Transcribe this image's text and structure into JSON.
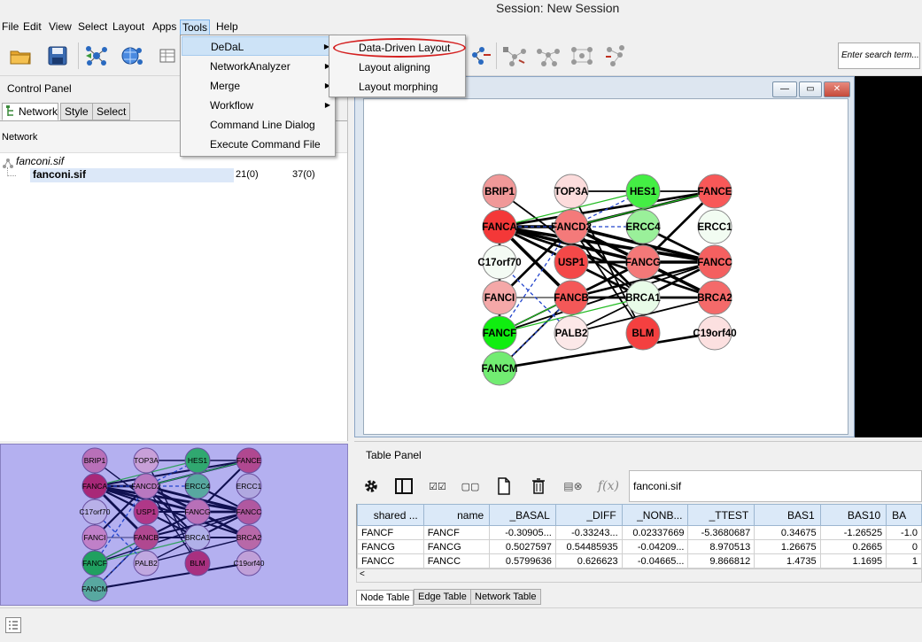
{
  "window": {
    "title": "Session: New Session"
  },
  "menubar": [
    "File",
    "Edit",
    "View",
    "Select",
    "Layout",
    "Apps",
    "Tools",
    "Help"
  ],
  "tools_menu": {
    "items": [
      {
        "label": "DeDaL",
        "submenu": true
      },
      {
        "label": "NetworkAnalyzer",
        "submenu": true
      },
      {
        "label": "Merge",
        "submenu": true
      },
      {
        "label": "Workflow",
        "submenu": true
      },
      {
        "label": "Command Line Dialog",
        "submenu": false
      },
      {
        "label": "Execute Command File",
        "submenu": false
      }
    ]
  },
  "dedal_menu": {
    "items": [
      "Data-Driven Layout",
      "Layout aligning",
      "Layout morphing"
    ]
  },
  "toolbar": {
    "search_placeholder": "Enter search term..."
  },
  "control_panel": {
    "title": "Control Panel",
    "tabs": [
      "Network",
      "Style",
      "Select"
    ],
    "column_header": "Network",
    "tree": {
      "root": "fanconi.sif",
      "child": "fanconi.sif",
      "nodes": "21(0)",
      "edges": "37(0)"
    }
  },
  "network_view": {
    "nodes": [
      {
        "id": "BRIP1",
        "color": "#f09898"
      },
      {
        "id": "TOP3A",
        "color": "#fcdcdc"
      },
      {
        "id": "HES1",
        "color": "#44ee44"
      },
      {
        "id": "FANCE",
        "color": "#f85858"
      },
      {
        "id": "FANCA",
        "color": "#f43838"
      },
      {
        "id": "FANCD2",
        "color": "#f47a7a"
      },
      {
        "id": "ERCC4",
        "color": "#9af09a"
      },
      {
        "id": "ERCC1",
        "color": "#f2fcf2"
      },
      {
        "id": "C17orf70",
        "color": "#f4fbf4"
      },
      {
        "id": "USP1",
        "color": "#f44848"
      },
      {
        "id": "FANCG",
        "color": "#f47878"
      },
      {
        "id": "FANCC",
        "color": "#f46060"
      },
      {
        "id": "FANCI",
        "color": "#f4a8a8"
      },
      {
        "id": "FANCB",
        "color": "#f45858"
      },
      {
        "id": "BRCA1",
        "color": "#e8fce8"
      },
      {
        "id": "BRCA2",
        "color": "#f46a6a"
      },
      {
        "id": "FANCF",
        "color": "#10ee10"
      },
      {
        "id": "PALB2",
        "color": "#fce8e8"
      },
      {
        "id": "BLM",
        "color": "#f44040"
      },
      {
        "id": "C19orf40",
        "color": "#fce0e0"
      },
      {
        "id": "FANCM",
        "color": "#72ec72"
      }
    ]
  },
  "birdseye": {
    "nodes": [
      {
        "id": "BRIP1",
        "color": "#b870b8"
      },
      {
        "id": "TOP3A",
        "color": "#c8a0d8"
      },
      {
        "id": "HES1",
        "color": "#30a870"
      },
      {
        "id": "FANCE",
        "color": "#b04890"
      },
      {
        "id": "FANCA",
        "color": "#a82878"
      },
      {
        "id": "FANCD2",
        "color": "#b878c0"
      },
      {
        "id": "ERCC4",
        "color": "#58a8a0"
      },
      {
        "id": "ERCC1",
        "color": "#b0a8e0"
      },
      {
        "id": "C17orf70",
        "color": "#b8b0e8"
      },
      {
        "id": "USP1",
        "color": "#b03888"
      },
      {
        "id": "FANCG",
        "color": "#b870b8"
      },
      {
        "id": "FANCC",
        "color": "#b058a0"
      },
      {
        "id": "FANCI",
        "color": "#c080c8"
      },
      {
        "id": "FANCB",
        "color": "#b04890"
      },
      {
        "id": "BRCA1",
        "color": "#b0b0e8"
      },
      {
        "id": "BRCA2",
        "color": "#b868a8"
      },
      {
        "id": "FANCF",
        "color": "#20a060"
      },
      {
        "id": "PALB2",
        "color": "#c0a8e0"
      },
      {
        "id": "BLM",
        "color": "#a83080"
      },
      {
        "id": "C19orf40",
        "color": "#c0a0d8"
      },
      {
        "id": "FANCM",
        "color": "#58a8a0"
      }
    ]
  },
  "table_panel": {
    "title": "Table Panel",
    "network_selector": "fanconi.sif",
    "columns": [
      "shared ...",
      "name",
      "_BASAL",
      "_DIFF",
      "_NONB...",
      "_TTEST",
      "BAS1",
      "BAS10",
      "BA"
    ],
    "rows": [
      [
        "FANCF",
        "FANCF",
        "-0.30905...",
        "-0.33243...",
        "0.02337669",
        "-5.3680687",
        "0.34675",
        "-1.26525",
        "-1.0"
      ],
      [
        "FANCG",
        "FANCG",
        "0.5027597",
        "0.54485935",
        "-0.04209...",
        "8.970513",
        "1.26675",
        "0.2665",
        "0"
      ],
      [
        "FANCC",
        "FANCC",
        "0.5799636",
        "0.626623",
        "-0.04665...",
        "9.866812",
        "1.4735",
        "1.1695",
        "1"
      ]
    ],
    "bottom_tabs": [
      "Node Table",
      "Edge Table",
      "Network Table"
    ]
  },
  "colors": {
    "menu_highlight": "#cde3f7",
    "ellipse": "#d42020",
    "birdseye_bg": "#b4b0f0"
  }
}
